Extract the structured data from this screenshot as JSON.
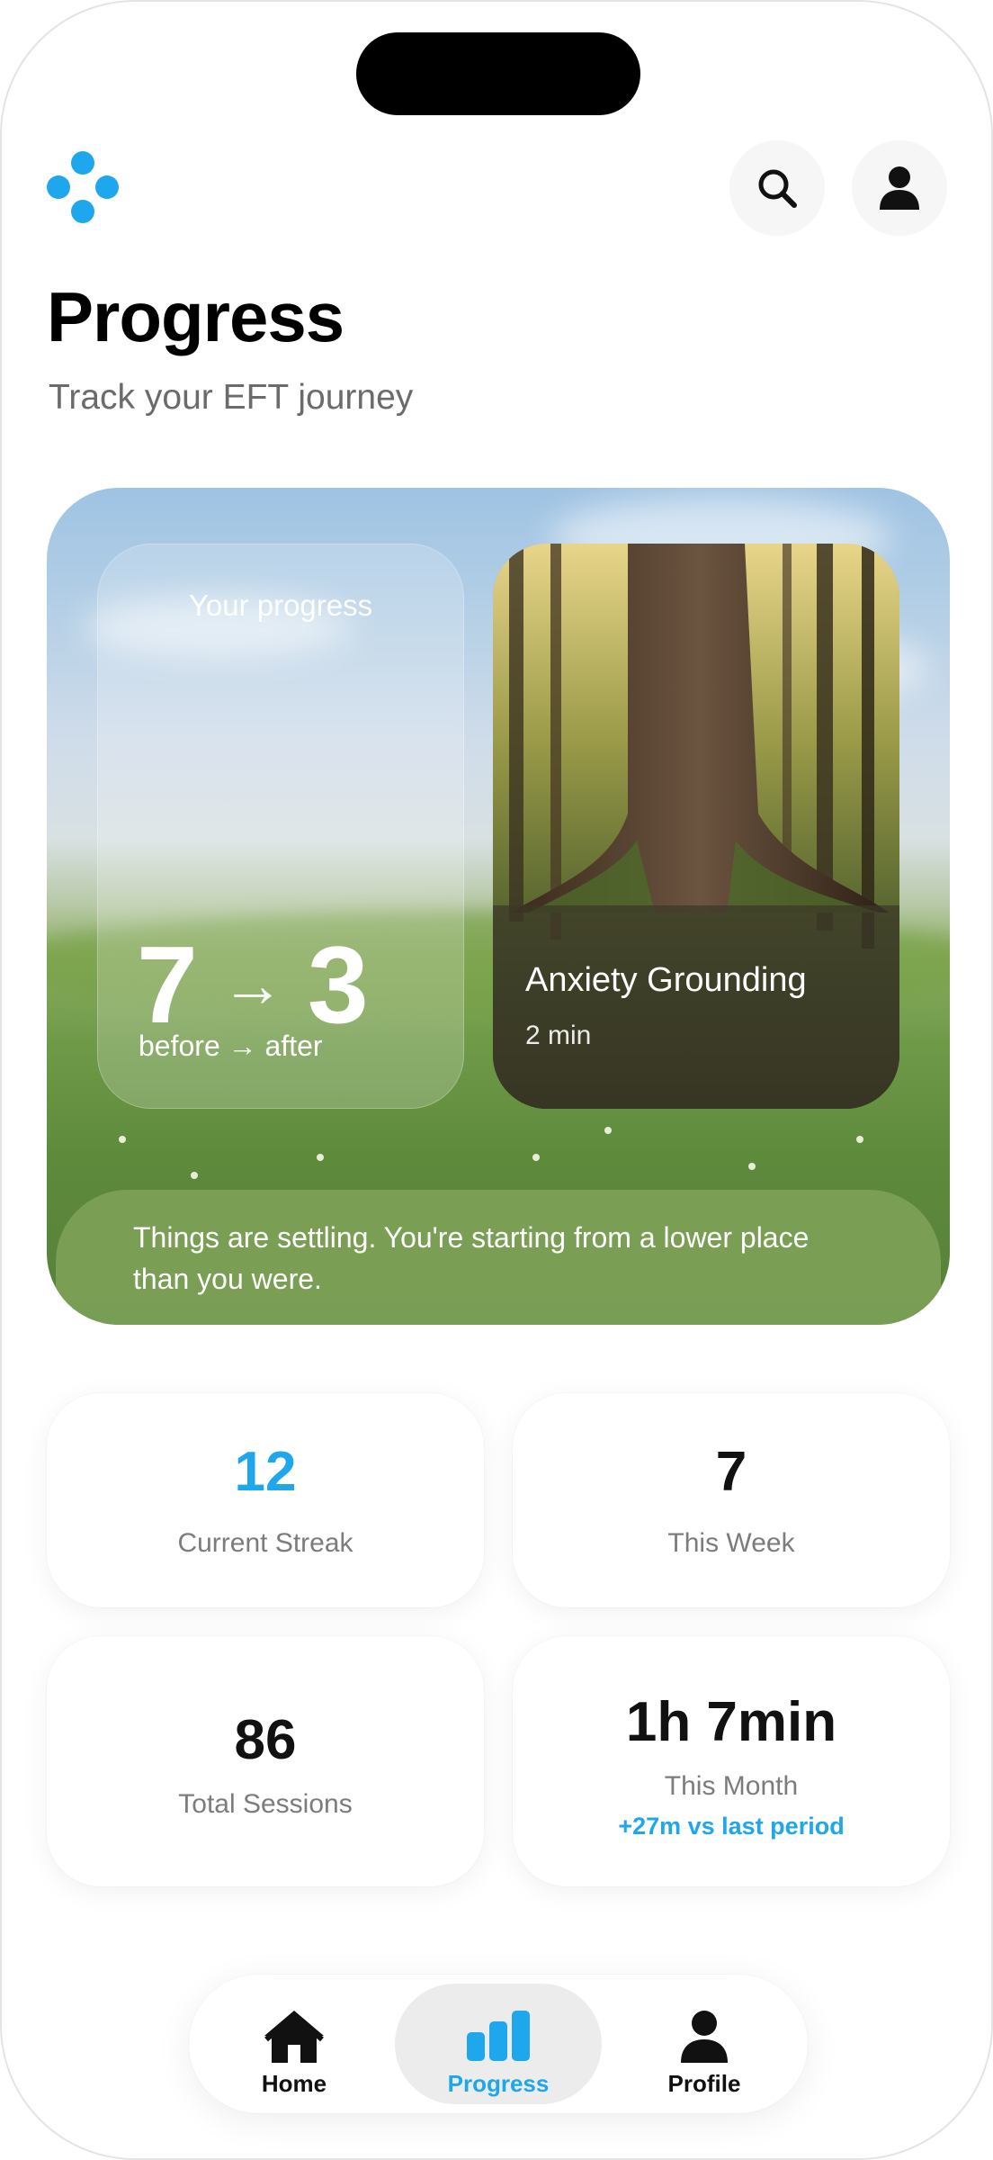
{
  "header": {
    "logo": "logo-icon",
    "search_icon": "search-icon",
    "profile_icon": "user-icon"
  },
  "page": {
    "title": "Progress",
    "subtitle": "Track your EFT journey"
  },
  "hero": {
    "progress_label": "Your progress",
    "before_value": "7",
    "after_value": "3",
    "arrow": "→",
    "caption": "before → after",
    "session_title": "Anxiety Grounding",
    "session_duration": "2 min",
    "message": "Things are settling. You're starting from a lower place than you were."
  },
  "stats": {
    "streak": {
      "value": "12",
      "label": "Current Streak",
      "color": "#1ea7ec"
    },
    "week": {
      "value": "7",
      "label": "This Week"
    },
    "total": {
      "value": "86",
      "label": "Total Sessions"
    },
    "month": {
      "value": "1h 7min",
      "label": "This Month",
      "delta": "+27m vs last period"
    }
  },
  "nav": {
    "items": [
      {
        "label": "Home",
        "icon": "home-icon",
        "active": false
      },
      {
        "label": "Progress",
        "icon": "bar-chart-icon",
        "active": true
      },
      {
        "label": "Profile",
        "icon": "user-icon",
        "active": false
      }
    ]
  },
  "colors": {
    "accent": "#1ea7ec"
  }
}
